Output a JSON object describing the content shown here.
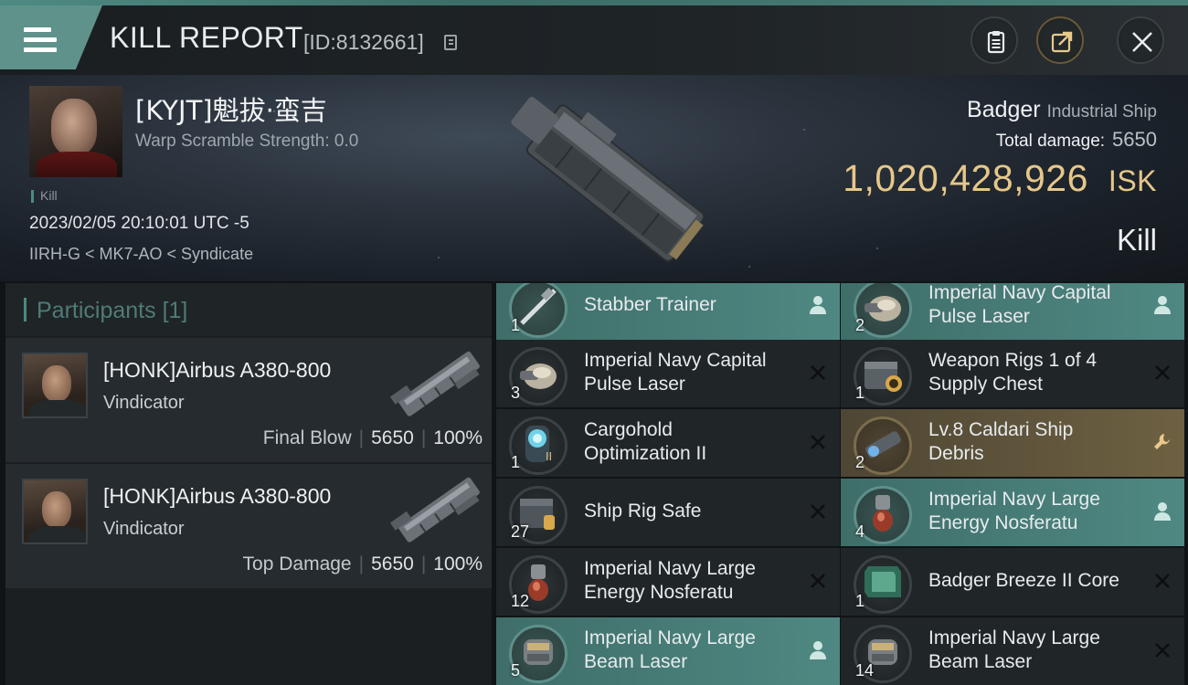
{
  "header": {
    "title": "KILL REPORT",
    "report_id": "[ID:8132661]",
    "buttons": [
      "notes-icon",
      "share-icon",
      "close-icon"
    ]
  },
  "victim": {
    "name": "[KYJT]魁拔·蛮吉",
    "warp_scramble": "Warp Scramble Strength: 0.0",
    "tag": "Kill",
    "datetime": "2023/02/05 20:10:01 UTC -5",
    "location": "IIRH-G < MK7-AO < Syndicate",
    "ship_name": "Badger",
    "ship_class": "Industrial Ship",
    "total_damage_label": "Total damage:",
    "total_damage_value": "5650",
    "isk_value": "1,020,428,926",
    "isk_unit": "ISK",
    "result": "Kill"
  },
  "participants": {
    "label": "Participants",
    "count": "[1]",
    "list": [
      {
        "name": "[HONK]Airbus A380-800",
        "ship": "Vindicator",
        "stat_label": "Final Blow",
        "damage": "5650",
        "percent": "100%"
      },
      {
        "name": "[HONK]Airbus A380-800",
        "ship": "Vindicator",
        "stat_label": "Top Damage",
        "damage": "5650",
        "percent": "100%"
      }
    ]
  },
  "items": [
    {
      "qty": "1",
      "name_line1": "Stabber Trainer",
      "name_line2": "",
      "status": "dropped",
      "style": "teal",
      "icon": "trainer-icon"
    },
    {
      "qty": "2",
      "name_line1": "Imperial Navy Capital",
      "name_line2": "Pulse Laser",
      "status": "dropped",
      "style": "teal",
      "icon": "pulse-laser-icon"
    },
    {
      "qty": "3",
      "name_line1": "Imperial Navy Capital",
      "name_line2": "Pulse Laser",
      "status": "destroyed",
      "style": "dark",
      "icon": "pulse-laser-icon"
    },
    {
      "qty": "1",
      "name_line1": "Weapon Rigs 1 of 4",
      "name_line2": "Supply Chest",
      "status": "destroyed",
      "style": "dark",
      "icon": "supply-chest-icon"
    },
    {
      "qty": "1",
      "name_line1": "Cargohold",
      "name_line2": "Optimization II",
      "status": "destroyed",
      "style": "dark",
      "icon": "cargohold-rig-icon"
    },
    {
      "qty": "2",
      "name_line1": "Lv.8 Caldari Ship",
      "name_line2": "Debris",
      "status": "salvage",
      "style": "gold",
      "icon": "debris-icon"
    },
    {
      "qty": "27",
      "name_line1": "Ship Rig Safe",
      "name_line2": "",
      "status": "destroyed",
      "style": "dark",
      "icon": "rig-safe-icon"
    },
    {
      "qty": "4",
      "name_line1": "Imperial Navy Large",
      "name_line2": "Energy Nosferatu",
      "status": "dropped",
      "style": "teal",
      "icon": "nosferatu-icon"
    },
    {
      "qty": "12",
      "name_line1": "Imperial Navy Large",
      "name_line2": "Energy Nosferatu",
      "status": "destroyed",
      "style": "dark",
      "icon": "nosferatu-icon"
    },
    {
      "qty": "1",
      "name_line1": "Badger Breeze II Core",
      "name_line2": "",
      "status": "destroyed",
      "style": "dark",
      "icon": "core-icon"
    },
    {
      "qty": "5",
      "name_line1": "Imperial Navy Large",
      "name_line2": "Beam Laser",
      "status": "dropped",
      "style": "teal",
      "icon": "beam-laser-icon"
    },
    {
      "qty": "14",
      "name_line1": "Imperial Navy Large",
      "name_line2": "Beam Laser",
      "status": "destroyed",
      "style": "dark",
      "icon": "beam-laser-icon"
    }
  ],
  "colors": {
    "accent_teal": "#4f8882",
    "isk_gold": "#e6c78a",
    "salvage_gold": "#6e6142"
  }
}
